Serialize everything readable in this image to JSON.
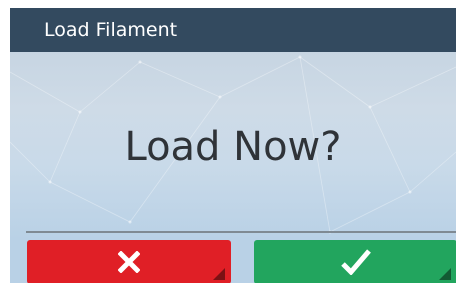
{
  "header": {
    "title": "Load Filament"
  },
  "dialog": {
    "prompt": "Load Now?"
  },
  "buttons": {
    "cancel": {
      "icon": "close-icon",
      "color": "#e01f26"
    },
    "confirm": {
      "icon": "checkmark-icon",
      "color": "#22a55e"
    }
  },
  "colors": {
    "header_bg": "#334a5f",
    "header_text": "#ffffff",
    "prompt_text": "#2f3338"
  }
}
